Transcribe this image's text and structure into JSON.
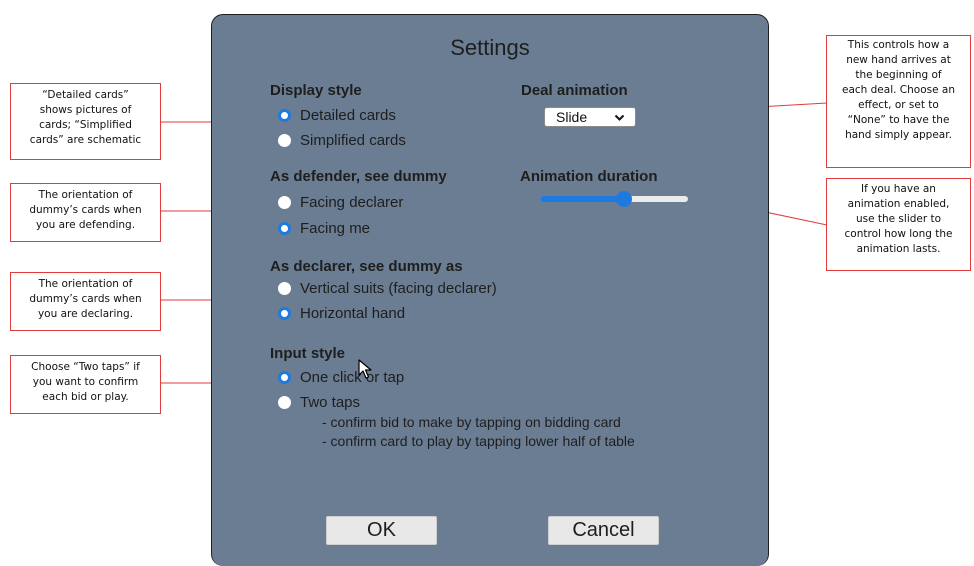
{
  "dialog": {
    "title": "Settings",
    "display_style": {
      "heading": "Display style",
      "options": [
        {
          "label": "Detailed cards",
          "checked": true
        },
        {
          "label": "Simplified cards",
          "checked": false
        }
      ]
    },
    "deal_animation": {
      "heading": "Deal animation",
      "selected": "Slide"
    },
    "animation_duration": {
      "heading": "Animation duration",
      "value_fraction": 0.57
    },
    "defender_dummy": {
      "heading": "As defender, see dummy",
      "options": [
        {
          "label": "Facing declarer",
          "checked": false
        },
        {
          "label": "Facing me",
          "checked": true
        }
      ]
    },
    "declarer_dummy": {
      "heading": "As declarer, see dummy as",
      "options": [
        {
          "label": "Vertical suits (facing declarer)",
          "checked": false
        },
        {
          "label": "Horizontal hand",
          "checked": true
        }
      ]
    },
    "input_style": {
      "heading": "Input style",
      "options": [
        {
          "label": "One click or tap",
          "checked": true
        },
        {
          "label": "Two taps",
          "checked": false
        }
      ],
      "notes": [
        "- confirm bid to make by tapping on bidding card",
        "- confirm card to play by tapping lower half of table"
      ]
    },
    "ok_label": "OK",
    "cancel_label": "Cancel"
  },
  "callouts": {
    "display_style": [
      "“Detailed cards”",
      "shows pictures of",
      "cards; “Simplified",
      "cards” are schematic"
    ],
    "defender": [
      "The orientation of",
      "dummy’s cards when",
      "you are defending."
    ],
    "declarer": [
      "The orientation of",
      "dummy’s cards when",
      "you are declaring."
    ],
    "input": [
      "Choose “Two taps” if",
      "you want to confirm",
      "each bid or play."
    ],
    "deal_animation": [
      "This controls how a",
      "new hand arrives at",
      "the beginning of",
      "each deal. Choose an",
      "effect, or set to",
      "“None” to have the",
      "hand simply appear."
    ],
    "duration": [
      "If you have an",
      "animation enabled,",
      "use the slider to",
      "control how long the",
      "animation lasts."
    ]
  },
  "colors": {
    "dialog_bg": "#6b7d92",
    "accent": "#1f7ae0",
    "callout_border": "#e23b3b"
  },
  "icons": {
    "select_arrow": "chevron-down-icon",
    "cursor": "mouse-pointer-icon"
  }
}
